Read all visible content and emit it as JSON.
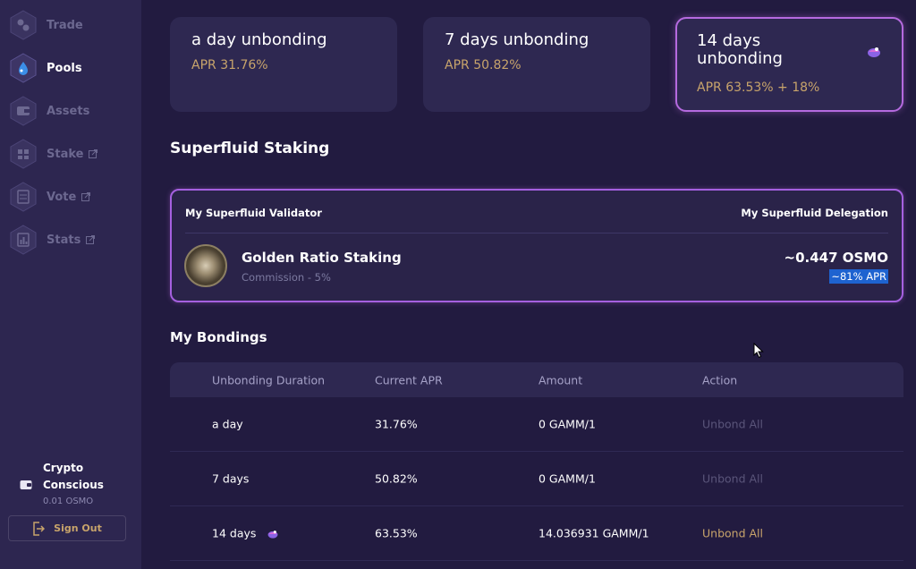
{
  "sidebar": {
    "items": [
      {
        "label": "Trade",
        "icon": "trade-icon",
        "external": false,
        "active": false
      },
      {
        "label": "Pools",
        "icon": "pools-icon",
        "external": false,
        "active": true
      },
      {
        "label": "Assets",
        "icon": "assets-icon",
        "external": false,
        "active": false
      },
      {
        "label": "Stake",
        "icon": "stake-icon",
        "external": true,
        "active": false
      },
      {
        "label": "Vote",
        "icon": "vote-icon",
        "external": true,
        "active": false
      },
      {
        "label": "Stats",
        "icon": "stats-icon",
        "external": true,
        "active": false
      }
    ],
    "user": {
      "name": "Crypto Conscious",
      "balance": "0.01 OSMO"
    },
    "sign_out_label": "Sign Out"
  },
  "unbonding_cards": [
    {
      "title": "a day unbonding",
      "apr": "APR 31.76%",
      "selected": false
    },
    {
      "title": "7 days unbonding",
      "apr": "APR 50.82%",
      "selected": false
    },
    {
      "title": "14 days unbonding",
      "apr": "APR 63.53% + 18%",
      "selected": true
    }
  ],
  "superfluid": {
    "section_title": "Superfluid Staking",
    "validator_header": "My Superfluid Validator",
    "delegation_header": "My Superfluid Delegation",
    "validator_name": "Golden Ratio Staking",
    "commission": "Commission - 5%",
    "delegation_amount": "~0.447 OSMO",
    "delegation_apr": "~81% APR"
  },
  "bondings": {
    "section_title": "My Bondings",
    "columns": [
      "Unbonding Duration",
      "Current APR",
      "Amount",
      "Action"
    ],
    "rows": [
      {
        "duration": "a day",
        "apr": "31.76%",
        "amount": "0 GAMM/1",
        "action": "Unbond All",
        "action_enabled": false,
        "superfluid": false
      },
      {
        "duration": "7 days",
        "apr": "50.82%",
        "amount": "0 GAMM/1",
        "action": "Unbond All",
        "action_enabled": false,
        "superfluid": false
      },
      {
        "duration": "14 days",
        "apr": "63.53%",
        "amount": "14.036931 GAMM/1",
        "action": "Unbond All",
        "action_enabled": true,
        "superfluid": true
      }
    ]
  },
  "colors": {
    "background": "#221b40",
    "sidebar": "#2d2650",
    "card": "#2e2851",
    "apr_gold": "#c8a46b",
    "accent_border": "#b56adf",
    "highlight_blue": "#1e63d0"
  }
}
